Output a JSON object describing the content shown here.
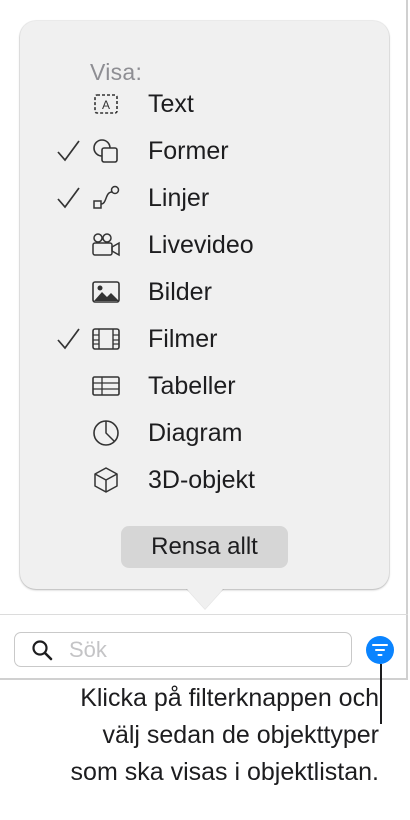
{
  "popover": {
    "header": "Visa:",
    "items": [
      {
        "label": "Text",
        "icon": "text-box-icon",
        "checked": false
      },
      {
        "label": "Former",
        "icon": "shapes-icon",
        "checked": true
      },
      {
        "label": "Linjer",
        "icon": "lines-icon",
        "checked": true
      },
      {
        "label": "Livevideo",
        "icon": "live-video-icon",
        "checked": false
      },
      {
        "label": "Bilder",
        "icon": "image-icon",
        "checked": false
      },
      {
        "label": "Filmer",
        "icon": "film-icon",
        "checked": true
      },
      {
        "label": "Tabeller",
        "icon": "table-icon",
        "checked": false
      },
      {
        "label": "Diagram",
        "icon": "chart-icon",
        "checked": false
      },
      {
        "label": "3D-objekt",
        "icon": "cube-icon",
        "checked": false
      }
    ],
    "clear_label": "Rensa allt"
  },
  "search": {
    "placeholder": "Sök",
    "value": ""
  },
  "filter_button": {
    "icon": "filter-icon",
    "color": "#0a84ff"
  },
  "caption": {
    "line1": "Klicka på filterknappen och",
    "line2": "välj sedan de objekttyper",
    "line3": "som ska visas i objektlistan."
  }
}
